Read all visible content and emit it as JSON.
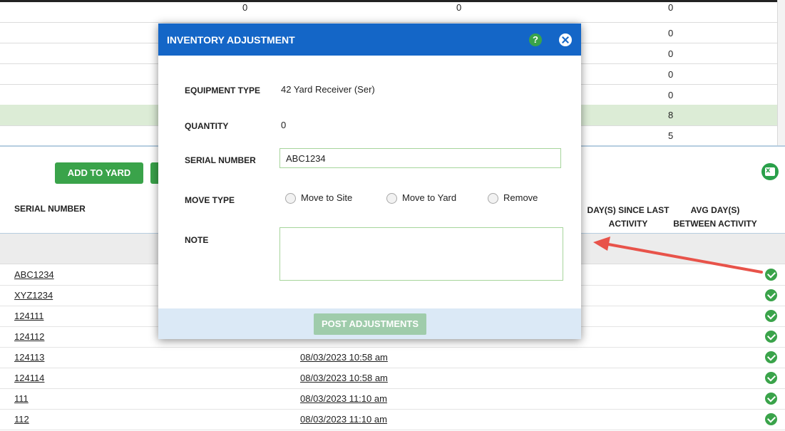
{
  "top_table": {
    "header_values": [
      "0",
      "0",
      "0"
    ],
    "right_values": [
      "0",
      "0",
      "0",
      "0",
      "8",
      "5"
    ]
  },
  "toolbar": {
    "add_to_yard_label": "ADD TO YARD",
    "excel_icon": "excel-export-icon"
  },
  "table": {
    "headers": {
      "serial_number": "SERIAL NUMBER",
      "days_since_last_activity": "DAY(S) SINCE LAST ACTIVITY",
      "avg_days_between_activity": "AVG DAY(S) BETWEEN ACTIVITY"
    },
    "rows": [
      {
        "serial": "ABC1234",
        "date": ""
      },
      {
        "serial": "XYZ1234",
        "date": ""
      },
      {
        "serial": "124111",
        "date": ""
      },
      {
        "serial": "124112",
        "date": ""
      },
      {
        "serial": "124113",
        "date": "08/03/2023 10:58 am"
      },
      {
        "serial": "124114",
        "date": "08/03/2023 10:58 am"
      },
      {
        "serial": "111",
        "date": "08/03/2023 11:10 am"
      },
      {
        "serial": "112",
        "date": "08/03/2023 11:10 am"
      }
    ]
  },
  "modal": {
    "title": "INVENTORY ADJUSTMENT",
    "help_label": "?",
    "equipment_type_label": "EQUIPMENT TYPE",
    "equipment_type_value": "42 Yard Receiver (Ser)",
    "quantity_label": "QUANTITY",
    "quantity_value": "0",
    "serial_number_label": "SERIAL NUMBER",
    "serial_number_value": "ABC1234",
    "move_type_label": "MOVE TYPE",
    "move_options": [
      "Move to Site",
      "Move to Yard",
      "Remove"
    ],
    "note_label": "NOTE",
    "post_button_label": "POST ADJUSTMENTS"
  },
  "colors": {
    "header_blue": "#1466c7",
    "accent_green": "#3aa34a",
    "highlight_row": "#dcecd6",
    "annotation_arrow": "#e8534a"
  }
}
